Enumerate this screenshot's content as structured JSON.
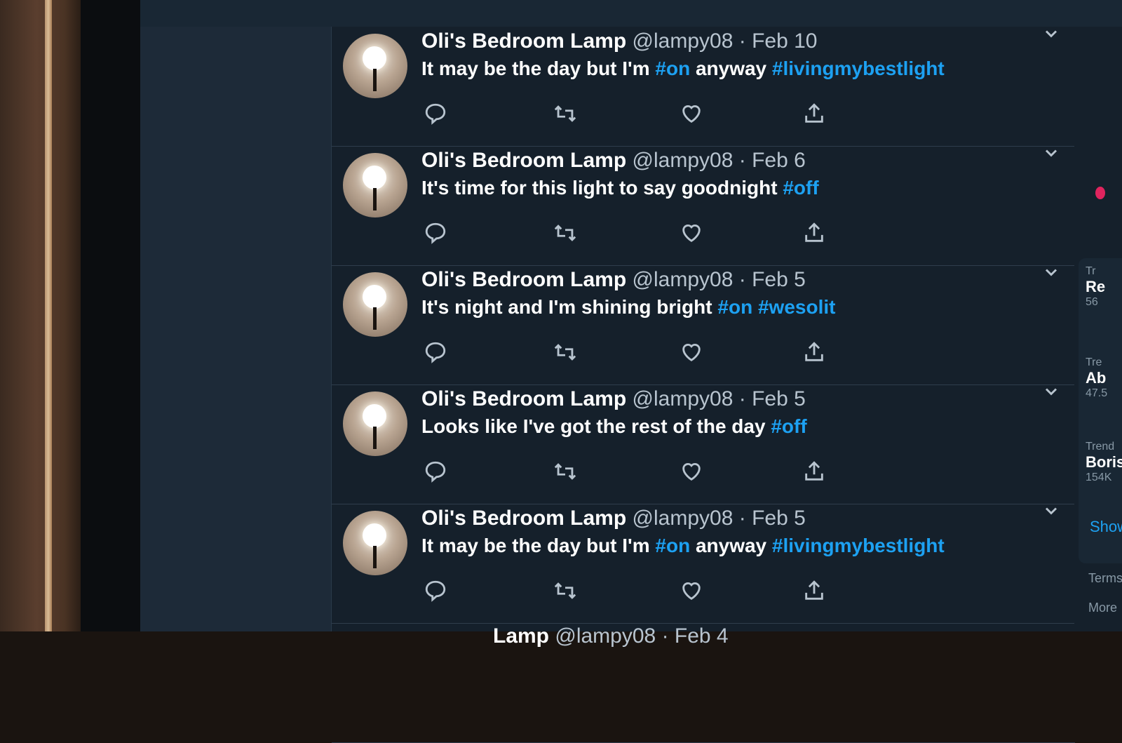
{
  "tweets": [
    {
      "name": "Oli's Bedroom Lamp",
      "handle": "@lampy08",
      "date": "Feb 10",
      "text": "It may be the day but I'm",
      "tags": [
        "#on",
        "#livingmybestlight"
      ],
      "mid": "anyway"
    },
    {
      "name": "Oli's Bedroom Lamp",
      "handle": "@lampy08",
      "date": "Feb 6",
      "text": "It's time for this light to say goodnight",
      "tags": [
        "#off"
      ],
      "mid": ""
    },
    {
      "name": "Oli's Bedroom Lamp",
      "handle": "@lampy08",
      "date": "Feb 5",
      "text": "It's night and I'm shining bright",
      "tags": [
        "#on #wesolit"
      ],
      "mid": ""
    },
    {
      "name": "Oli's Bedroom Lamp",
      "handle": "@lampy08",
      "date": "Feb 5",
      "text": "Looks like I've got the rest of the day",
      "tags": [
        "#off"
      ],
      "mid": ""
    },
    {
      "name": "Oli's Bedroom Lamp",
      "handle": "@lampy08",
      "date": "Feb 5",
      "text": "It may be the day but I'm",
      "tags": [
        "#on",
        "#livingmybestlight"
      ],
      "mid": "anyway"
    },
    {
      "name": "Lamp",
      "handle": "@lampy08",
      "date": "Feb 4",
      "text": "",
      "tags": [],
      "mid": ""
    }
  ],
  "separator": "·",
  "sidebar": {
    "trends": [
      {
        "small": "Tr",
        "bold": "Re",
        "count": "56"
      },
      {
        "small": "Tre",
        "bold": "Ab",
        "count": "47.5"
      },
      {
        "small": "Trend",
        "bold": "Boris",
        "count": "154K"
      }
    ],
    "show_more": "Show",
    "footer": [
      "Terms",
      "More"
    ]
  },
  "colors": {
    "background": "#15202b",
    "hashtag": "#1da1f2",
    "text": "#ffffff",
    "muted": "#b8c4cf"
  },
  "icons": [
    "reply-icon",
    "retweet-icon",
    "like-icon",
    "share-icon",
    "chevron-down-icon",
    "lamp-avatar"
  ]
}
